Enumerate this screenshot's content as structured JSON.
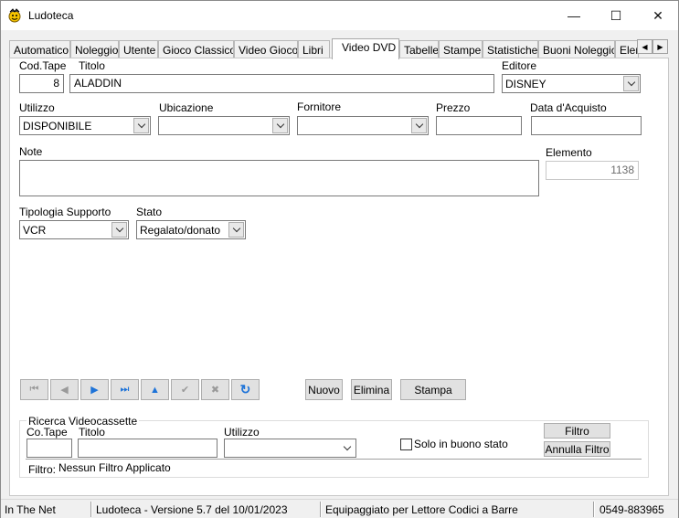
{
  "window": {
    "title": "Ludoteca",
    "min": "—",
    "max": "☐",
    "close": "✕"
  },
  "tabs": [
    {
      "label": "Automatico"
    },
    {
      "label": "Noleggio"
    },
    {
      "label": "Utente"
    },
    {
      "label": "Gioco Classico"
    },
    {
      "label": "Video Gioco"
    },
    {
      "label": "Libri"
    },
    {
      "label": "Video DVD",
      "active": true
    },
    {
      "label": "Tabelle"
    },
    {
      "label": "Stampe"
    },
    {
      "label": "Statistiche"
    },
    {
      "label": "Buoni Noleggio"
    },
    {
      "label": "Elementi"
    }
  ],
  "tab_scroll": {
    "left": "◀",
    "right": "▶"
  },
  "form": {
    "cod_tape": {
      "label": "Cod.Tape",
      "value": "8"
    },
    "titolo": {
      "label": "Titolo",
      "value": "ALADDIN"
    },
    "editore": {
      "label": "Editore",
      "value": "DISNEY"
    },
    "utilizzo": {
      "label": "Utilizzo",
      "value": "DISPONIBILE"
    },
    "ubicazione": {
      "label": "Ubicazione",
      "value": ""
    },
    "fornitore": {
      "label": "Fornitore",
      "value": ""
    },
    "prezzo": {
      "label": "Prezzo",
      "value": ""
    },
    "data_acquisto": {
      "label": "Data d'Acquisto",
      "value": ""
    },
    "note": {
      "label": "Note",
      "value": ""
    },
    "elemento": {
      "label": "Elemento",
      "value": "1138"
    },
    "tipologia": {
      "label": "Tipologia Supporto",
      "value": "VCR"
    },
    "stato": {
      "label": "Stato",
      "value": "Regalato/donato"
    }
  },
  "nav": {
    "first": "⏮",
    "prev": "◀",
    "next": "▶",
    "last": "⏭",
    "up": "▲",
    "confirm": "✔",
    "cancel": "✖",
    "refresh": "↻"
  },
  "actions": {
    "nuovo": "Nuovo",
    "elimina": "Elimina",
    "stampa": "Stampa"
  },
  "search": {
    "title": "Ricerca Videocassette",
    "co_tape_label": "Co.Tape",
    "titolo_label": "Titolo",
    "utilizzo_label": "Utilizzo",
    "solo_buono": "Solo in buono stato",
    "filtro_btn": "Filtro",
    "annulla_btn": "Annulla Filtro",
    "filtro_label": "Filtro:",
    "filtro_value": "Nessun Filtro Applicato"
  },
  "statusbar": {
    "company": "In The Net",
    "version": "Ludoteca - Versione 5.7 del 10/01/2023",
    "equip": "Equipaggiato per Lettore Codici a Barre",
    "phone": "0549-883965"
  },
  "colors": {
    "nav_blue": "#1e73d8",
    "disabled_gray": "#9a9a9a"
  }
}
